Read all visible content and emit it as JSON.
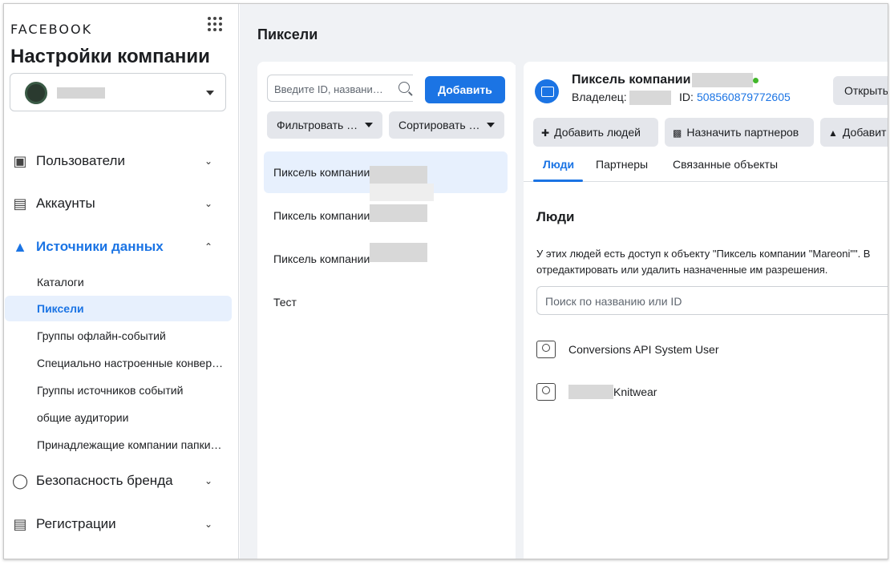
{
  "sidebar": {
    "brand": "FACEBOOK",
    "title": "Настройки компании",
    "nav": [
      {
        "label": "Пользователи",
        "icon": "user-badge-icon"
      },
      {
        "label": "Аккаунты",
        "icon": "archive-icon"
      },
      {
        "label": "Источники данных",
        "icon": "data-sources-icon"
      },
      {
        "label": "Безопасность бренда",
        "icon": "shield-icon"
      },
      {
        "label": "Регистрации",
        "icon": "clipboard-icon"
      }
    ],
    "sub_items": [
      "Каталоги",
      "Пиксели",
      "Группы офлайн-событий",
      "Специально настроенные конвер…",
      "Группы источников событий",
      "общие аудитории",
      "Принадлежащие компании папки…"
    ],
    "selected_sub_item": "Пиксели"
  },
  "main": {
    "title": "Пиксели",
    "list": {
      "search_placeholder": "Введите ID, названи…",
      "add_label": "Добавить",
      "filter_label": "Фильтровать …",
      "sort_label": "Сортировать …",
      "items": [
        "Пиксель компании",
        "Пиксель компании",
        "Пиксель компании",
        "Тест"
      ]
    },
    "detail": {
      "title": "Пиксель компании",
      "owner_label": "Владелец:",
      "id_label": "ID:",
      "id_value": "508560879772605",
      "open_label": "Открыть",
      "actions": [
        "Добавить людей",
        "Назначить партнеров",
        "Добавит"
      ],
      "tabs": [
        "Люди",
        "Партнеры",
        "Связанные объекты"
      ],
      "section_title": "Люди",
      "description": "У этих людей есть доступ к объекту \"Пиксель компании \"Mareoni\"\". В отредактировать или удалить назначенные им разрешения.",
      "people_search_placeholder": "Поиск по названию или ID",
      "people": [
        "Conversions API System User",
        "Knitwear"
      ]
    }
  },
  "colors": {
    "accent": "#1b74e4",
    "online": "#42b72a"
  }
}
